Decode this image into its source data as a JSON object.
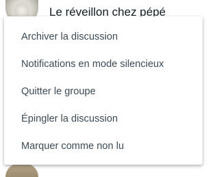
{
  "chat": {
    "title": "Le réveillon chez pépé"
  },
  "menu": {
    "items": [
      "Archiver la discussion",
      "Notifications en mode silencieux",
      "Quitter le groupe",
      "Épingler la discussion",
      "Marquer comme non lu"
    ]
  }
}
